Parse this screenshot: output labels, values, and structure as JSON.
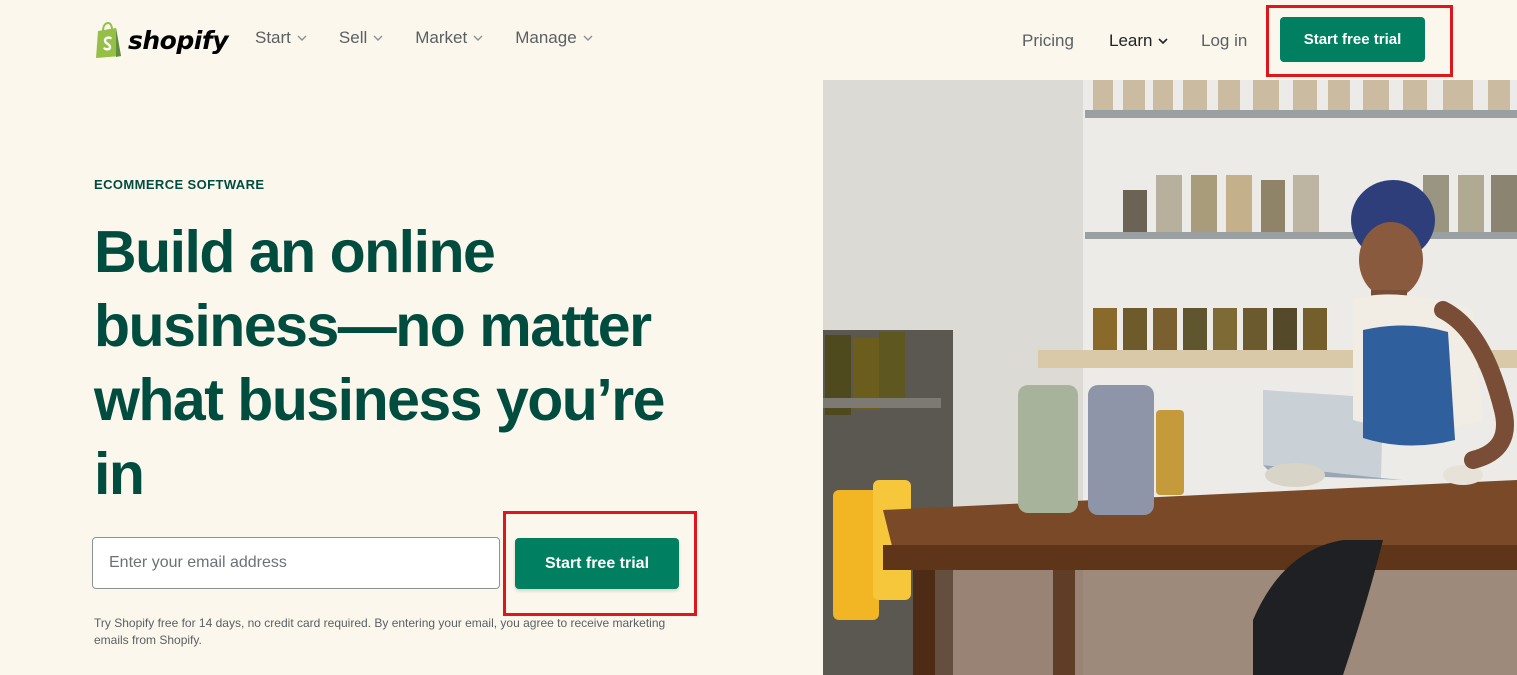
{
  "brand": {
    "name": "shopify",
    "color": "#008060",
    "dark": "#004c3f"
  },
  "nav": {
    "left": [
      {
        "label": "Start"
      },
      {
        "label": "Sell"
      },
      {
        "label": "Market"
      },
      {
        "label": "Manage"
      }
    ],
    "pricing": "Pricing",
    "learn": "Learn",
    "login": "Log in",
    "cta": "Start free trial"
  },
  "hero": {
    "eyebrow": "ECOMMERCE SOFTWARE",
    "title": "Build an online business—no matter what business you’re in",
    "email_placeholder": "Enter your email address",
    "cta": "Start free trial",
    "disclaimer": "Try Shopify free for 14 days, no credit card required. By entering your email, you agree to receive marketing emails from Shopify."
  },
  "highlight_color": "#e0161d"
}
